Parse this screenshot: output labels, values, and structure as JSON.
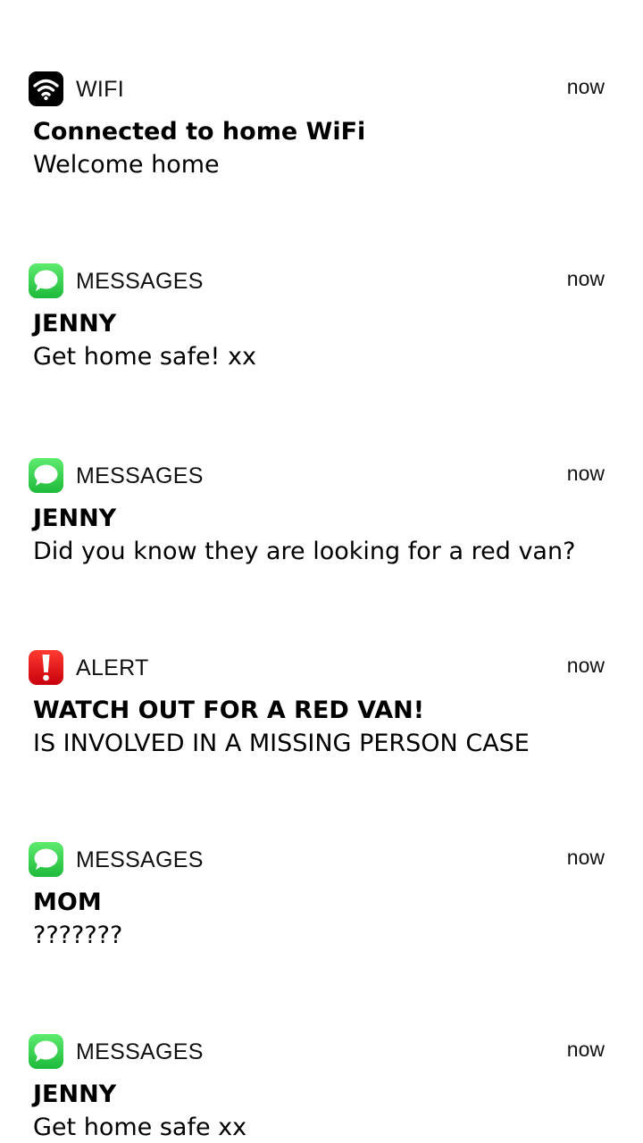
{
  "notifications": [
    {
      "app": "WIFI",
      "icon": "wifi-icon",
      "time": "now",
      "title": "Connected to home WiFi",
      "body": "Welcome home"
    },
    {
      "app": "MESSAGES",
      "icon": "messages-icon",
      "time": "now",
      "title": "JENNY",
      "body": "Get home safe! xx"
    },
    {
      "app": "MESSAGES",
      "icon": "messages-icon",
      "time": "now",
      "title": "JENNY",
      "body": "Did you know they are looking for a red van?"
    },
    {
      "app": "ALERT",
      "icon": "alert-icon",
      "time": "now",
      "title": "WATCH OUT FOR A RED VAN!",
      "body": "IS INVOLVED IN A MISSING PERSON CASE"
    },
    {
      "app": "MESSAGES",
      "icon": "messages-icon",
      "time": "now",
      "title": "MOM",
      "body": "???????"
    },
    {
      "app": "MESSAGES",
      "icon": "messages-icon",
      "time": "now",
      "title": "JENNY",
      "body": "Get home safe xx"
    }
  ],
  "colors": {
    "messages_green": "#34C759",
    "alert_red": "#E0121B",
    "wifi_black": "#000000"
  }
}
